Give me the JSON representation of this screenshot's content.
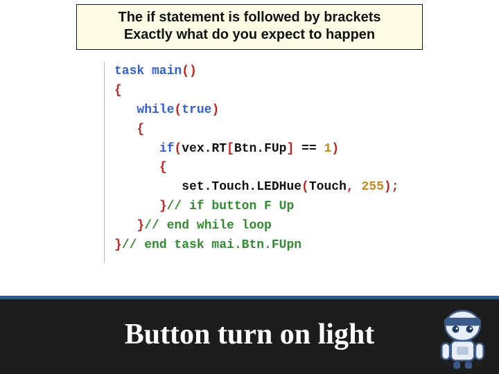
{
  "header": {
    "line1": "The if statement is followed by brackets",
    "line2": "Exactly what do you expect to happen"
  },
  "code": {
    "l1_kw": "task main",
    "l1_pn": "()",
    "l2_pn": "{",
    "l3_kw": "while",
    "l3_pn1": "(",
    "l3_kw2": "true",
    "l3_pn2": ")",
    "l4_pn": "{",
    "l5_kw": "if",
    "l5_pn1": "(",
    "l5_txt": "vex.RT",
    "l5_pn2": "[",
    "l5_id": "Btn.FUp",
    "l5_pn3": "]",
    "l5_op": " == ",
    "l5_num": "1",
    "l5_pn4": ")",
    "l6_pn": "{",
    "l7_fn": "set.Touch.LEDHue",
    "l7_pn1": "(",
    "l7_arg1": "Touch",
    "l7_cm": ", ",
    "l7_num": "255",
    "l7_pn2": ");",
    "l8_pn": "}",
    "l8_c": "// if button F Up",
    "l9_pn": "}",
    "l9_c": "// end while loop",
    "l10_pn": "}",
    "l10_c": "// end task mai.Btn.FUpn"
  },
  "footer": {
    "title": "Button turn on light"
  }
}
